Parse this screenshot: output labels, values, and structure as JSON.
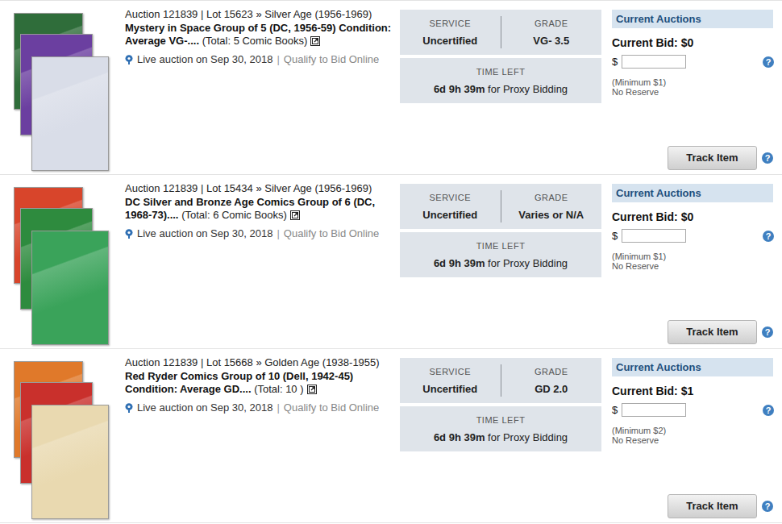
{
  "lots": [
    {
      "header": "Auction 121839 | Lot 15623 » Silver Age (1956-1969)",
      "title": "Mystery in Space Group of 5 (DC, 1956-59) Condition: Average VG-....",
      "total": "(Total: 5 Comic Books)",
      "live": "Live auction on Sep 30, 2018",
      "divider": "|",
      "qualify": "Qualify to Bid Online",
      "service_label": "SERVICE",
      "service": "Uncertified",
      "grade_label": "GRADE",
      "grade": "VG- 3.5",
      "time_label": "TIME LEFT",
      "time_left": "6d 9h 39m",
      "time_suffix": "for Proxy Bidding",
      "panel_title": "Current Auctions",
      "bid_label": "Current Bid:",
      "bid": "$0",
      "currency": "$",
      "minimum": "(Minimum $1)",
      "reserve": "No Reserve",
      "track": "Track Item",
      "bid_help": "?",
      "track_help": "?"
    },
    {
      "header": "Auction 121839 | Lot 15434 » Silver Age (1956-1969)",
      "title": "DC Silver and Bronze Age Comics Group of 6 (DC, 1968-73)....",
      "total": "(Total: 6 Comic Books)",
      "live": "Live auction on Sep 30, 2018",
      "divider": "|",
      "qualify": "Qualify to Bid Online",
      "service_label": "SERVICE",
      "service": "Uncertified",
      "grade_label": "GRADE",
      "grade": "Varies or N/A",
      "time_label": "TIME LEFT",
      "time_left": "6d 9h 39m",
      "time_suffix": "for Proxy Bidding",
      "panel_title": "Current Auctions",
      "bid_label": "Current Bid:",
      "bid": "$0",
      "currency": "$",
      "minimum": "(Minimum $1)",
      "reserve": "No Reserve",
      "track": "Track Item",
      "bid_help": "?",
      "track_help": "?"
    },
    {
      "header": "Auction 121839 | Lot 15668 » Golden Age (1938-1955)",
      "title": "Red Ryder Comics Group of 10 (Dell, 1942-45) Condition: Average GD....",
      "total": "(Total: 10 )",
      "live": "Live auction on Sep 30, 2018",
      "divider": "|",
      "qualify": "Qualify to Bid Online",
      "service_label": "SERVICE",
      "service": "Uncertified",
      "grade_label": "GRADE",
      "grade": "GD 2.0",
      "time_label": "TIME LEFT",
      "time_left": "6d 9h 39m",
      "time_suffix": "for Proxy Bidding",
      "panel_title": "Current Auctions",
      "bid_label": "Current Bid:",
      "bid": "$1",
      "currency": "$",
      "minimum": "(Minimum $2)",
      "reserve": "No Reserve",
      "track": "Track Item",
      "bid_help": "?",
      "track_help": "?"
    }
  ]
}
